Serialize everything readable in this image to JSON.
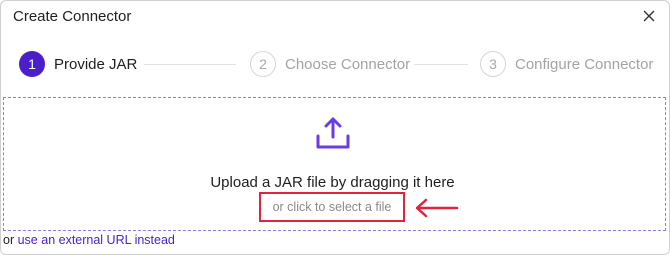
{
  "dialog": {
    "title": "Create Connector"
  },
  "steps": [
    {
      "number": "1",
      "label": "Provide JAR",
      "active": true
    },
    {
      "number": "2",
      "label": "Choose Connector",
      "active": false
    },
    {
      "number": "3",
      "label": "Configure Connector",
      "active": false
    }
  ],
  "upload": {
    "prompt": "Upload a JAR file by dragging it here",
    "select_link": "or click to select a file"
  },
  "footer": {
    "prefix": "or",
    "link": "use an external URL instead"
  },
  "colors": {
    "accent": "#4a1fc9",
    "annotation": "#e0243a",
    "muted": "#a3a3a3"
  },
  "icons": [
    "close-icon",
    "upload-icon",
    "annotation-arrow-icon"
  ]
}
